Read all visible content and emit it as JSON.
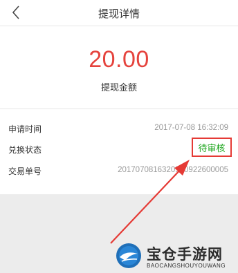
{
  "header": {
    "title": "提现详情",
    "back_icon": "chevron-left-icon"
  },
  "amount": {
    "value": "20.00",
    "label": "提现金额"
  },
  "details": {
    "rows": [
      {
        "label": "申请时间",
        "value": "2017-07-08 16:32:09"
      },
      {
        "label": "兑换状态",
        "value": "待审核"
      },
      {
        "label": "交易单号",
        "value": "2017070816320920922600005"
      }
    ]
  },
  "colors": {
    "amount": "#e5433d",
    "status": "#1ba51b",
    "highlight": "#e53a35"
  },
  "watermark": {
    "title": "宝仓手游网",
    "subtitle": "BAOCANGSHOUYOUWANG"
  }
}
